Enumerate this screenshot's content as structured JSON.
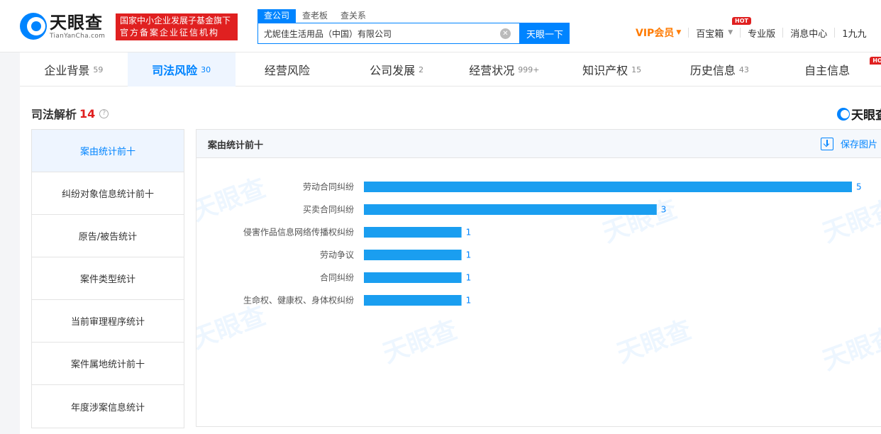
{
  "header": {
    "logo_cn": "天眼查",
    "logo_en": "TianYanCha.com",
    "slogan_line1": "国家中小企业发展子基金旗下",
    "slogan_line2": "官方备案企业征信机构",
    "search_tabs": [
      {
        "label": "查公司",
        "active": true
      },
      {
        "label": "查老板",
        "active": false
      },
      {
        "label": "查关系",
        "active": false
      }
    ],
    "search_value": "尤妮佳生活用品（中国）有限公司",
    "search_button": "天眼一下",
    "nav": {
      "vip": "VIP会员",
      "baibaoxiang": "百宝箱",
      "hot_badge": "HOT",
      "pro": "专业版",
      "messages": "消息中心",
      "user": "1九九"
    }
  },
  "category_tabs": [
    {
      "label": "企业背景",
      "count": "59",
      "active": false
    },
    {
      "label": "司法风险",
      "count": "30",
      "active": true
    },
    {
      "label": "经营风险",
      "count": "",
      "active": false
    },
    {
      "label": "公司发展",
      "count": "2",
      "active": false
    },
    {
      "label": "经营状况",
      "count": "999+",
      "active": false
    },
    {
      "label": "知识产权",
      "count": "15",
      "active": false
    },
    {
      "label": "历史信息",
      "count": "43",
      "active": false
    },
    {
      "label": "自主信息",
      "count": "",
      "active": false,
      "hot": "HOT"
    }
  ],
  "section": {
    "title": "司法解析",
    "count": "14",
    "brand": "天眼查"
  },
  "side_menu": [
    {
      "label": "案由统计前十",
      "active": true
    },
    {
      "label": "纠纷对象信息统计前十",
      "active": false
    },
    {
      "label": "原告/被告统计",
      "active": false
    },
    {
      "label": "案件类型统计",
      "active": false
    },
    {
      "label": "当前审理程序统计",
      "active": false
    },
    {
      "label": "案件属地统计前十",
      "active": false
    },
    {
      "label": "年度涉案信息统计",
      "active": false
    }
  ],
  "panel": {
    "title": "案由统计前十",
    "save_label": "保存图片"
  },
  "watermark_text": "天眼查",
  "colors": {
    "primary": "#0084ff",
    "bar": "#1a9ef0",
    "hot": "#e02020",
    "vip": "#ff7a00"
  },
  "chart_data": {
    "type": "bar",
    "orientation": "horizontal",
    "categories": [
      "劳动合同纠纷",
      "买卖合同纠纷",
      "侵害作品信息网络传播权纠纷",
      "劳动争议",
      "合同纠纷",
      "生命权、健康权、身体权纠纷"
    ],
    "values": [
      5,
      3,
      1,
      1,
      1,
      1
    ],
    "xlim": [
      0,
      5
    ],
    "grid": false,
    "data_labels": true
  }
}
